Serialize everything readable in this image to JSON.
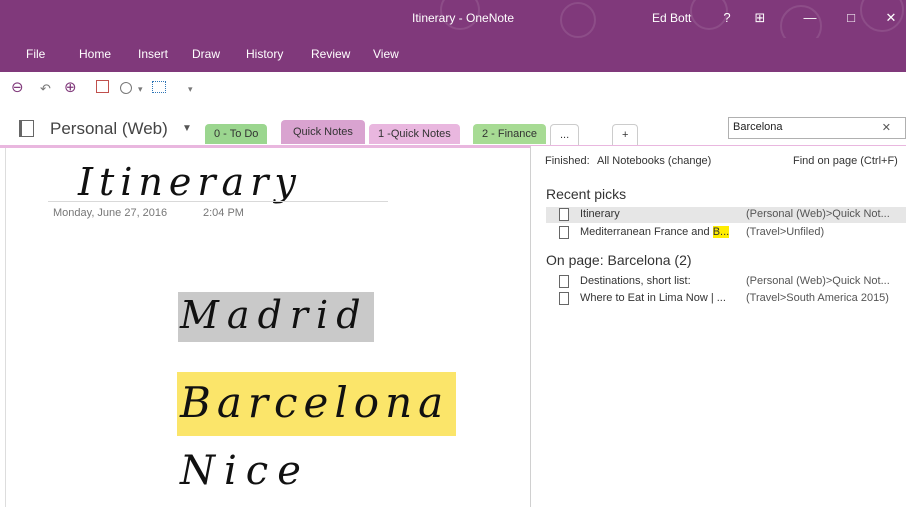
{
  "window": {
    "title": "Itinerary - OneNote",
    "user": "Ed Bott",
    "help": "?",
    "restore_glyph": "⊞",
    "minimize": "—",
    "maximize": "□",
    "close": "✕"
  },
  "ribbon": {
    "tabs": [
      "File",
      "Home",
      "Insert",
      "Draw",
      "History",
      "Review",
      "View"
    ]
  },
  "qat": {
    "back_icon": "⊖",
    "undo_icon": "↶",
    "forward_icon": "⊕",
    "more": "▾"
  },
  "nav": {
    "notebook_name": "Personal (Web)",
    "dropdown": "▼",
    "sections": [
      "0 - To Do",
      "Quick Notes",
      "1 -Quick Notes",
      "2 - Finance",
      "...",
      "+"
    ],
    "section_colors": [
      "#9bd68f",
      "#d9a3d0",
      "#e9b7df",
      "#a7db94",
      "#ffffff",
      "#ffffff"
    ]
  },
  "search": {
    "value": "Barcelona",
    "clear_icon": "✕"
  },
  "page": {
    "title": "Itinerary",
    "date": "Monday, June 27, 2016",
    "time": "2:04 PM",
    "ink": [
      {
        "text": "Madrid",
        "highlight": "#c9c9c9"
      },
      {
        "text": "Barcelona",
        "highlight": "#fbe56a"
      },
      {
        "text": "Nice",
        "highlight": ""
      }
    ]
  },
  "results": {
    "scope_prefix": "Finished:",
    "scope": "All Notebooks (change)",
    "find_on_page": "Find on page (Ctrl+F)",
    "recent_heading": "Recent picks",
    "recent": [
      {
        "name": "Itinerary",
        "location": "(Personal (Web)>Quick Not...",
        "selected": true
      },
      {
        "name_pre": "Mediterranean France and ",
        "name_hl": "B...",
        "location": "(Travel>Unfiled)",
        "selected": false
      }
    ],
    "onpage_heading": "On page:  Barcelona (2)",
    "onpage": [
      {
        "name": "Destinations, short list:",
        "location": "(Personal (Web)>Quick Not..."
      },
      {
        "name": "Where to Eat in Lima Now | ...",
        "location": "(Travel>South America 2015)"
      }
    ]
  },
  "colors": {
    "accent": "#80397b",
    "highlight_yellow": "#fbe56a",
    "highlight_gray": "#c9c9c9"
  }
}
